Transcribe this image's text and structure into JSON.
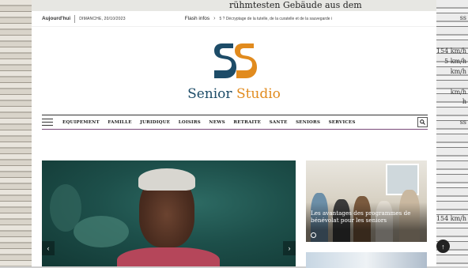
{
  "background": {
    "top_text": "rühmtesten Gebäude aus dem",
    "right_texts": [
      "ss",
      "154 km/h",
      "5 km/h",
      "km/h",
      "km/h",
      "h",
      "ss",
      "154 km/h"
    ]
  },
  "topbar": {
    "today_label": "Aujourd'hui",
    "date": "DIMANCHE, 20/10/2023",
    "flash_label": "Flash infos",
    "ticker_text": "5 ? Décryptage de la tutelle, de la curatelle et de la sauvegarde i"
  },
  "logo": {
    "name_part1": "Senior",
    "name_part2": "Studio",
    "colors": {
      "primary": "#1d4c68",
      "accent": "#e18b1e"
    }
  },
  "nav": {
    "items": [
      "EQUIPEMENT",
      "FAMILLE",
      "JURIDIQUE",
      "LOISIRS",
      "NEWS",
      "RETRAITE",
      "SANTE",
      "SENIORS",
      "SERVICES"
    ],
    "menu_icon": "hamburger-icon",
    "search_icon": "search-icon"
  },
  "hero": {
    "prev_icon": "chevron-left-icon",
    "next_icon": "chevron-right-icon"
  },
  "side_card": {
    "title": "Les avantages des programmes de bénévolat pour les seniors",
    "time_icon": "clock-icon"
  },
  "scroll_top": {
    "icon": "arrow-up-icon",
    "label": "↑"
  }
}
